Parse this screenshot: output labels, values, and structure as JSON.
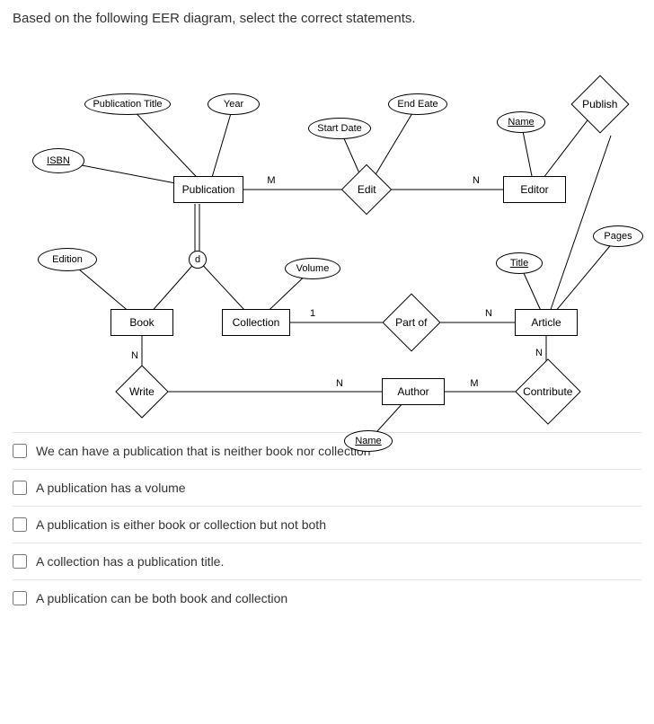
{
  "question": "Based on the following EER diagram, select the correct statements.",
  "entities": {
    "publication": "Publication",
    "editor": "Editor",
    "book": "Book",
    "collection": "Collection",
    "article": "Article",
    "author": "Author"
  },
  "relationships": {
    "edit": "Edit",
    "partof": "Part of",
    "write": "Write",
    "contribute": "Contribute",
    "publish": "Publish"
  },
  "attributes": {
    "pubtitle": "Publication Title",
    "year": "Year",
    "isbn": "ISBN",
    "startdate": "Start Date",
    "endeate": "End Eate",
    "name_editor": "Name",
    "edition": "Edition",
    "volume": "Volume",
    "title": "Title",
    "pages": "Pages",
    "name_author": "Name"
  },
  "generalization": "d",
  "cardinalities": {
    "edit_pub": "M",
    "edit_editor": "N",
    "partof_coll": "1",
    "partof_art": "N",
    "write_book": "N",
    "write_auth": "N",
    "contribute_art": "N",
    "contribute_auth": "M"
  },
  "options": [
    "We can have a publication that is neither book nor collection",
    "A publication has a volume",
    "A publication is either book or collection but not both",
    "A collection has a publication title.",
    "A publication can be both book and collection"
  ]
}
